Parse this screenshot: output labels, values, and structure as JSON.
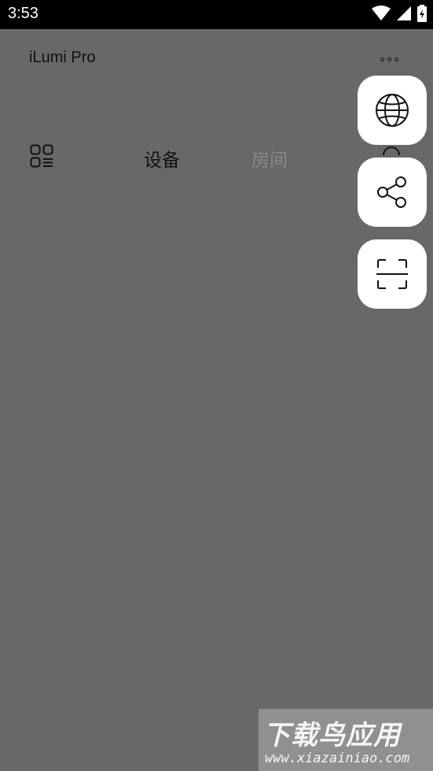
{
  "status_bar": {
    "time": "3:53"
  },
  "app": {
    "title": "iLumi Pro"
  },
  "tabs": [
    {
      "label": "设备",
      "active": true
    },
    {
      "label": "房间",
      "active": false
    }
  ],
  "fab_menu": [
    {
      "icon": "globe-icon"
    },
    {
      "icon": "share-icon"
    },
    {
      "icon": "scan-icon"
    }
  ],
  "watermark": {
    "main": "下载鸟应用",
    "url": "www.xiazainiao.com"
  },
  "colors": {
    "overlay": "#686868",
    "status_bar": "#000000",
    "fab": "#ffffff"
  }
}
